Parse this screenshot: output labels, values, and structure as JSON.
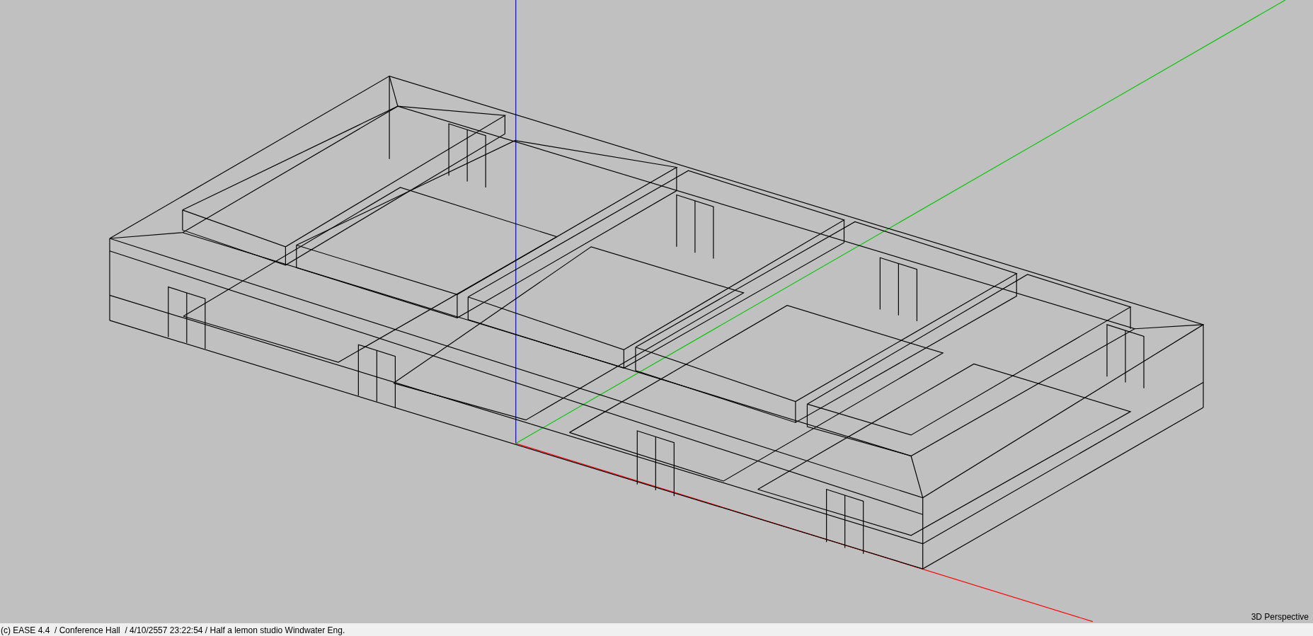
{
  "viewport": {
    "view_label": "3D Perspective"
  },
  "status_bar": {
    "text": "(c) EASE 4.4  / Conference Hall  / 4/10/2557 23:22:54 / Half a lemon studio Windwater Eng."
  }
}
